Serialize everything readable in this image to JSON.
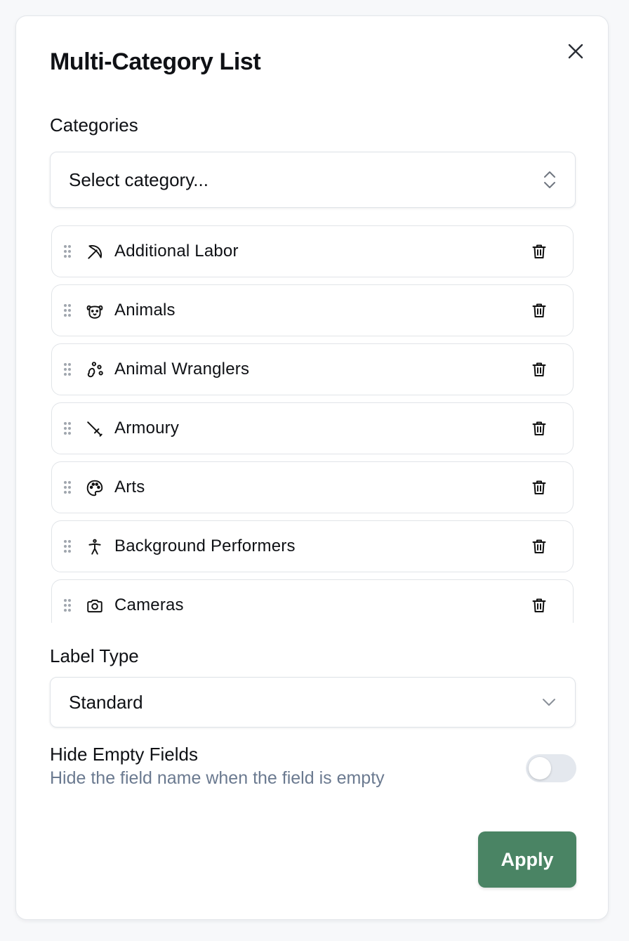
{
  "dialog": {
    "title": "Multi-Category List",
    "close_icon": "close-icon"
  },
  "categories": {
    "label": "Categories",
    "select_placeholder": "Select category...",
    "select_icon": "chevron-up-down-icon",
    "items": [
      {
        "label": "Additional Labor",
        "icon": "pickaxe-icon"
      },
      {
        "label": "Animals",
        "icon": "dog-face-icon"
      },
      {
        "label": "Animal Wranglers",
        "icon": "paw-print-icon"
      },
      {
        "label": "Armoury",
        "icon": "sword-icon"
      },
      {
        "label": "Arts",
        "icon": "palette-icon"
      },
      {
        "label": "Background Performers",
        "icon": "person-standing-icon"
      },
      {
        "label": "Cameras",
        "icon": "camera-icon"
      }
    ]
  },
  "label_type": {
    "label": "Label Type",
    "value": "Standard",
    "icon": "chevron-down-icon"
  },
  "hide_empty": {
    "title": "Hide Empty Fields",
    "description": "Hide the field name when the field is empty",
    "enabled": false
  },
  "footer": {
    "apply_label": "Apply",
    "accent_color": "#4a8464"
  }
}
